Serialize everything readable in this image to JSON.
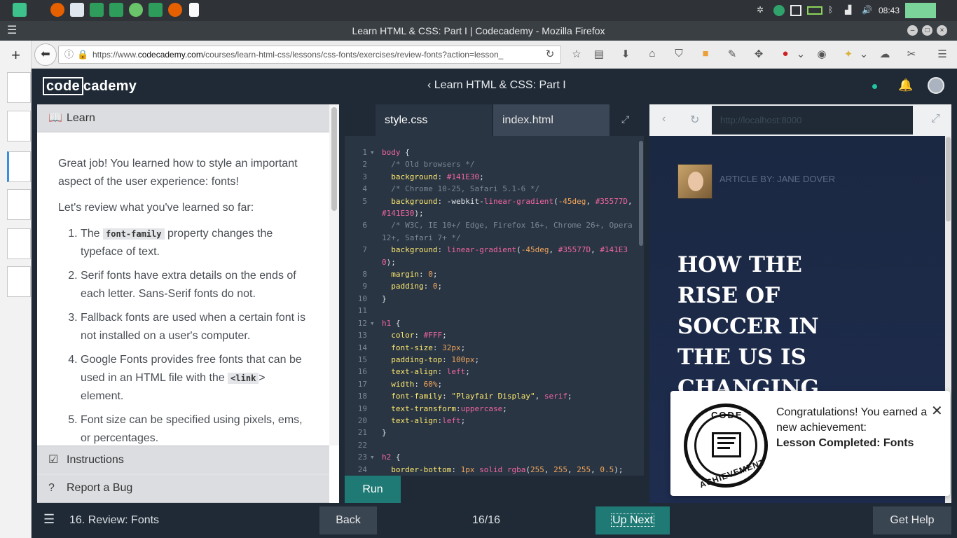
{
  "window": {
    "title": "Learn HTML & CSS: Part I | Codecademy - Mozilla Firefox"
  },
  "taskbar": {
    "time": "08:43"
  },
  "browser": {
    "url_prefix": "https://www.",
    "url_domain": "codecademy.com",
    "url_rest": "/courses/learn-html-css/lessons/css-fonts/exercises/review-fonts?action=lesson_"
  },
  "header": {
    "logo_a": "code",
    "logo_b": "cademy",
    "course_title": "Learn HTML & CSS: Part I",
    "course_chevron": "‹"
  },
  "learn": {
    "tab_label": "Learn",
    "intro": "Great job! You learned how to style an important aspect of the user experience: fonts!",
    "review_lead": "Let's review what you've learned so far:",
    "items": [
      {
        "pre": "The ",
        "code": "font-family",
        "post": " property changes the typeface of text."
      },
      {
        "pre": "Serif fonts have extra details on the ends of each letter. Sans-Serif fonts do not.",
        "code": "",
        "post": ""
      },
      {
        "pre": "Fallback fonts are used when a certain font is not installed on a user's computer.",
        "code": "",
        "post": ""
      },
      {
        "pre": "Google Fonts provides free fonts that can be used in an HTML file with the ",
        "code": "<link",
        "post": "> element."
      },
      {
        "pre": "Font size can be specified using pixels, ems, or percentages.",
        "code": "",
        "post": ""
      }
    ],
    "instructions_label": "Instructions",
    "report_label": "Report a Bug"
  },
  "editor": {
    "tabs": [
      "style.css",
      "index.html"
    ],
    "run_label": "Run",
    "lines": [
      {
        "n": "1",
        "f": "▾",
        "h": "<span class='sel'>body</span> {"
      },
      {
        "n": "2",
        "f": "",
        "h": "  <span class='cm'>/* Old browsers */</span>"
      },
      {
        "n": "3",
        "f": "",
        "h": "  <span class='prop'>background</span>: <span class='val'>#141E30</span>;"
      },
      {
        "n": "4",
        "f": "",
        "h": "  <span class='cm'>/* Chrome 10-25, Safari 5.1-6 */</span>"
      },
      {
        "n": "5",
        "f": "",
        "h": "  <span class='prop'>background</span>: -webkit-<span class='val'>linear-gradient</span>(<span class='num'>-45deg</span>, <span class='val'>#35577D</span>, <span class='val'>#141E30</span>);"
      },
      {
        "n": "6",
        "f": "",
        "h": "  <span class='cm'>/* W3C, IE 10+/ Edge, Firefox 16+, Chrome 26+, Opera 12+, Safari 7+ */</span>"
      },
      {
        "n": "7",
        "f": "",
        "h": "  <span class='prop'>background</span>: <span class='val'>linear-gradient</span>(<span class='num'>-45deg</span>, <span class='val'>#35577D</span>, <span class='val'>#141E30</span>);"
      },
      {
        "n": "8",
        "f": "",
        "h": "  <span class='prop'>margin</span>: <span class='num'>0</span>;"
      },
      {
        "n": "9",
        "f": "",
        "h": "  <span class='prop'>padding</span>: <span class='num'>0</span>;"
      },
      {
        "n": "10",
        "f": "",
        "h": "}"
      },
      {
        "n": "11",
        "f": "",
        "h": ""
      },
      {
        "n": "12",
        "f": "▾",
        "h": "<span class='sel'>h1</span> {"
      },
      {
        "n": "13",
        "f": "",
        "h": "  <span class='prop'>color</span>: <span class='val'>#FFF</span>;"
      },
      {
        "n": "14",
        "f": "",
        "h": "  <span class='prop'>font-size</span>: <span class='num'>32px</span>;"
      },
      {
        "n": "15",
        "f": "",
        "h": "  <span class='prop'>padding-top</span>: <span class='num'>100px</span>;"
      },
      {
        "n": "16",
        "f": "",
        "h": "  <span class='prop'>text-align</span>: <span class='val'>left</span>;"
      },
      {
        "n": "17",
        "f": "",
        "h": "  <span class='prop'>width</span>: <span class='num'>60%</span>;"
      },
      {
        "n": "18",
        "f": "",
        "h": "  <span class='prop'>font-family</span>: <span class='str'>\"Playfair Display\"</span>, <span class='val'>serif</span>;"
      },
      {
        "n": "19",
        "f": "",
        "h": "  <span class='prop'>text-transform</span>:<span class='val'>uppercase</span>;"
      },
      {
        "n": "20",
        "f": "",
        "h": "  <span class='prop'>text-align</span>:<span class='val'>left</span>;"
      },
      {
        "n": "21",
        "f": "",
        "h": "}"
      },
      {
        "n": "22",
        "f": "",
        "h": ""
      },
      {
        "n": "23",
        "f": "▾",
        "h": "<span class='sel'>h2</span> {"
      },
      {
        "n": "24",
        "f": "",
        "h": "  <span class='prop'>border-bottom</span>: <span class='num'>1px</span> <span class='val'>solid</span> <span class='val'>rgba</span>(<span class='num'>255</span>, <span class='num'>255</span>, <span class='num'>255</span>, <span class='num'>0.5</span>);"
      }
    ]
  },
  "preview": {
    "url": "http://localhost:8000",
    "author": "Article by: Jane Dover",
    "headline": "How the rise of soccer in the US is changing"
  },
  "toast": {
    "message": "Congratulations! You earned a new achievement:",
    "title": "Lesson Completed: Fonts",
    "badge_top": "CODE",
    "badge_bottom": "ACHIEVEMENT"
  },
  "bottombar": {
    "lesson": "16. Review: Fonts",
    "back": "Back",
    "progress": "16/16",
    "up_next": "Up Next",
    "get_help": "Get Help"
  },
  "colors": {
    "accent": "#1f7a75",
    "navy": "#1f2a36",
    "dot": "#21c4a2"
  }
}
